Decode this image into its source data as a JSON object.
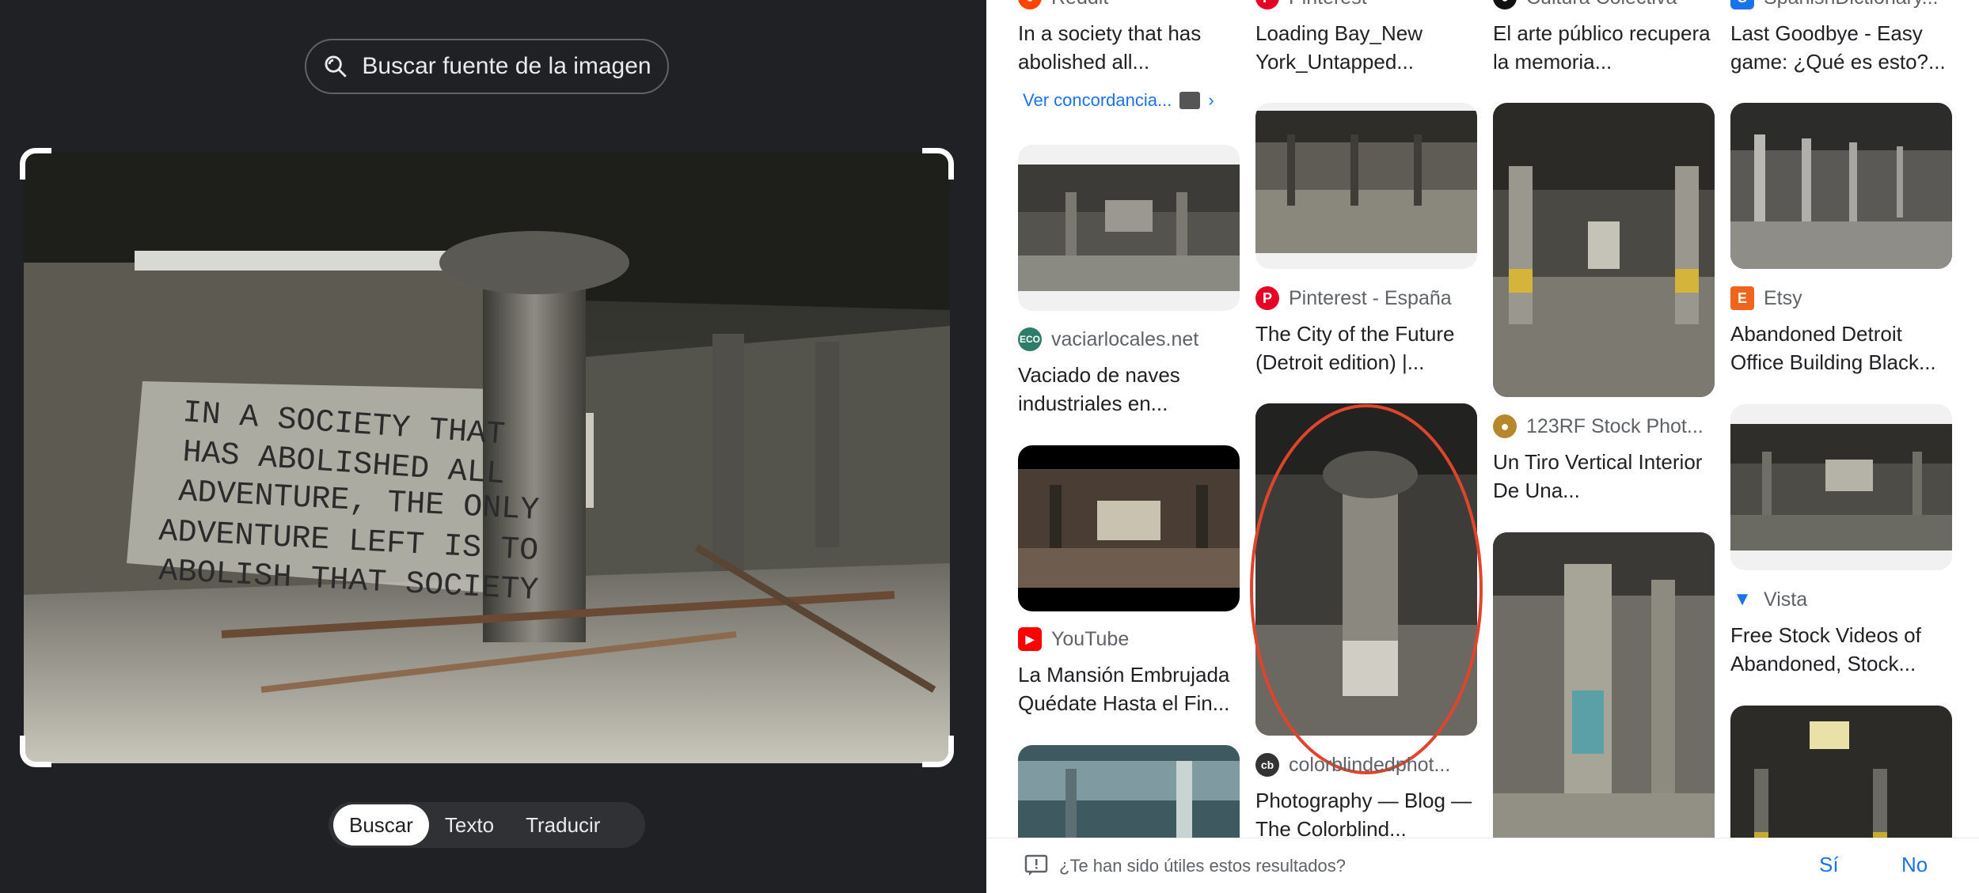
{
  "left": {
    "source_button_label": "Buscar fuente de la imagen",
    "modes": [
      "Buscar",
      "Texto",
      "Traducir"
    ],
    "active_mode": "Buscar",
    "photo_text": "IN A SOCIETY THAT HAS ABOLISHED ALL ADVENTURE, THE ONLY ADVENTURE LEFT IS TO ABOLISH THAT SOCIETY"
  },
  "results": {
    "col1": [
      {
        "source": "Reddit",
        "title": "In a society that has abolished all...",
        "match_link": "Ver concordancia...",
        "icon": "reddit-icon",
        "icon_color": "#ff4500"
      },
      {
        "source": "vaciarlocales.net",
        "title": "Vaciado de naves industriales en...",
        "icon": "eco-icon",
        "icon_color": "#2e7d6b"
      },
      {
        "source": "YouTube",
        "title": "La Mansión Embrujada Quédate Hasta el Fin...",
        "icon": "youtube-icon",
        "icon_color": "#ff0000"
      }
    ],
    "col2": [
      {
        "source": "Pinterest",
        "title": "Loading Bay_New York_Untapped...",
        "icon": "pinterest-icon",
        "icon_color": "#e60023"
      },
      {
        "source": "Pinterest - España",
        "title": "The City of the Future (Detroit edition) |...",
        "icon": "pinterest-icon",
        "icon_color": "#e60023"
      },
      {
        "source": "colorblindedphot...",
        "title": "Photography — Blog — The Colorblind...",
        "icon": "cb-icon",
        "icon_color": "#333333"
      }
    ],
    "col3": [
      {
        "source": "Cultura Colectiva",
        "title": "El arte público recupera la memoria...",
        "icon": "cultura-icon",
        "icon_color": "#111111"
      },
      {
        "source": "123RF Stock Phot...",
        "title": "Un Tiro Vertical Interior De Una...",
        "icon": "123rf-icon",
        "icon_color": "#b5892b"
      }
    ],
    "col4": [
      {
        "source": "SpanishDictionary...",
        "title": "Last Goodbye - Easy game: ¿Qué es esto?...",
        "icon": "spanishdict-icon",
        "icon_color": "#1a73e8"
      },
      {
        "source": "Etsy",
        "title": "Abandoned Detroit Office Building Black...",
        "icon": "etsy-icon",
        "icon_color": "#f1641e"
      },
      {
        "source": "Vista",
        "title": "Free Stock Videos of Abandoned, Stock...",
        "icon": "vista-icon",
        "icon_color": "#1a73e8"
      }
    ]
  },
  "feedback": {
    "question": "¿Te han sido útiles estos resultados?",
    "yes": "Sí",
    "no": "No"
  },
  "colors": {
    "dark_bg": "#202124",
    "link_blue": "#1a73e8",
    "annotation_red": "#e0442c"
  }
}
